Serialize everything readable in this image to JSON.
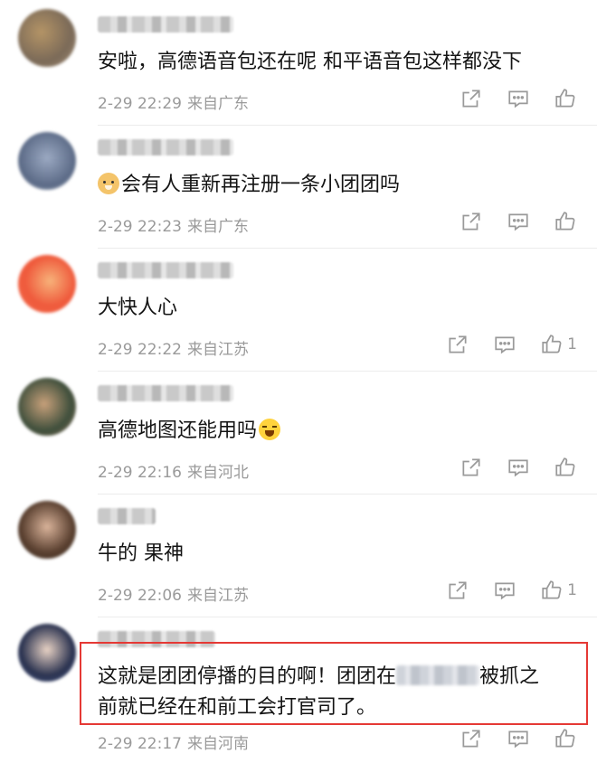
{
  "comments": [
    {
      "content": "安啦，高德语音包还在呢 和平语音包这样都没下",
      "date": "2-29 22:29",
      "location": "来自广东",
      "likes": ""
    },
    {
      "content": "会有人重新再注册一条小团团吗",
      "date": "2-29 22:23",
      "location": "来自广东",
      "likes": ""
    },
    {
      "content": "大快人心",
      "date": "2-29 22:22",
      "location": "来自江苏",
      "likes": "1"
    },
    {
      "content": "高德地图还能用吗",
      "date": "2-29 22:16",
      "location": "来自河北",
      "likes": ""
    },
    {
      "content": "牛的 果神",
      "date": "2-29 22:06",
      "location": "来自江苏",
      "likes": "1"
    },
    {
      "content_part1": "这就是团团停播的目的啊！团团在",
      "content_part2": "被抓之",
      "content_line2": "前就已经在和前工会打官司了。",
      "date": "2-29 22:17",
      "location": "来自河南",
      "likes": ""
    }
  ],
  "colors": {
    "highlight": "#e53935",
    "meta": "#9a9a9a",
    "text": "#141414"
  },
  "icons": [
    "share-icon",
    "comment-icon",
    "like-icon",
    "dog-emoji-icon",
    "laugh-cry-emoji-icon"
  ]
}
